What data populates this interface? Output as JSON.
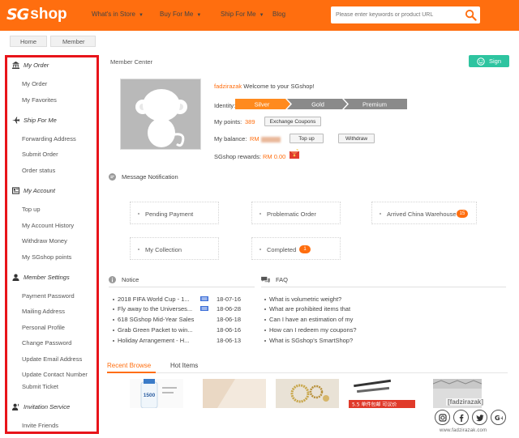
{
  "header": {
    "logo_mark": "SG",
    "logo_text": "shop",
    "nav": [
      {
        "label": "What's in Store",
        "caret": true
      },
      {
        "label": "Buy For Me",
        "caret": true
      },
      {
        "label": "Ship For Me",
        "caret": true
      },
      {
        "label": "Blog",
        "caret": false
      }
    ],
    "search_placeholder": "Please enter keywords or product URL"
  },
  "breadcrumb": [
    "Home",
    "Member"
  ],
  "sidebar": {
    "sections": [
      {
        "title": "My Order",
        "icon": "bank-icon",
        "items": [
          "My Order",
          "My Favorites"
        ]
      },
      {
        "title": "Ship For Me",
        "icon": "airplane-icon",
        "items": [
          "Forwarding Address",
          "Submit Order",
          "Order status"
        ]
      },
      {
        "title": "My Account",
        "icon": "ledger-icon",
        "items": [
          "Top up",
          "My Account History",
          "Withdraw Money",
          "My SGshop points"
        ]
      },
      {
        "title": "Member Settings",
        "icon": "user-icon",
        "items": [
          "Payment Password",
          "Mailing Address",
          "Personal Profile",
          "Change Password",
          "Update Email Address",
          "Update Contact Number",
          "Submit Ticket"
        ]
      },
      {
        "title": "Invitation Service",
        "icon": "user-plus-icon",
        "items": [
          "Invite Friends"
        ]
      }
    ]
  },
  "member": {
    "title": "Member Center",
    "sign_label": "Sign",
    "username": "fadzirazak",
    "welcome_text": " Welcome to your SGshop!",
    "identity_label": "Identity:",
    "tiers": [
      "Silver",
      "Gold",
      "Premium"
    ],
    "points_label": "My points:",
    "points_value": "389",
    "exchange_label": "Exchange Coupons",
    "balance_label": "My balance:",
    "balance_prefix": "RM",
    "topup_label": "Top up",
    "withdraw_label": "Withdraw",
    "rewards_label": "SGshop rewards:",
    "rewards_value": "RM 0.00"
  },
  "notifications": {
    "title": "Message Notification",
    "tiles": [
      {
        "label": "Pending Payment",
        "badge": ""
      },
      {
        "label": "Problematic Order",
        "badge": ""
      },
      {
        "label": "Arrived China Warehouse",
        "badge": "15"
      },
      {
        "label": "My Collection",
        "badge": ""
      },
      {
        "label": "Completed",
        "badge": "1"
      }
    ]
  },
  "notice": {
    "title": "Notice",
    "rows": [
      {
        "text": "2018 FIFA World Cup - 1...",
        "date": "18-07-16",
        "new": true
      },
      {
        "text": "Fly away to the Universes...",
        "date": "18-06-28",
        "new": true
      },
      {
        "text": "618 SGshop Mid-Year Sales",
        "date": "18-06-18",
        "new": false
      },
      {
        "text": "Grab Green Packet to win...",
        "date": "18-06-16",
        "new": false
      },
      {
        "text": "Holiday Arrangement - H...",
        "date": "18-06-13",
        "new": false
      }
    ]
  },
  "faq": {
    "title": "FAQ",
    "rows": [
      "What is volumetric weight?",
      "What are prohibited items that",
      "Can I have an estimation of my",
      "How can I redeem my coupons?",
      "What is SGshop's SmartShop?"
    ]
  },
  "browse_tabs": [
    "Recent Browse",
    "Hot Items"
  ],
  "thumb_texts": {
    "t1": "1500",
    "t5": "5.5 单件包邮 可议价"
  },
  "watermark": {
    "name": "[fadzirazak]",
    "url": "www.fadzirazak.com"
  },
  "colors": {
    "brand": "#ff6e0f",
    "sign": "#2ec4a0",
    "sidebar_border": "#e8141a"
  }
}
